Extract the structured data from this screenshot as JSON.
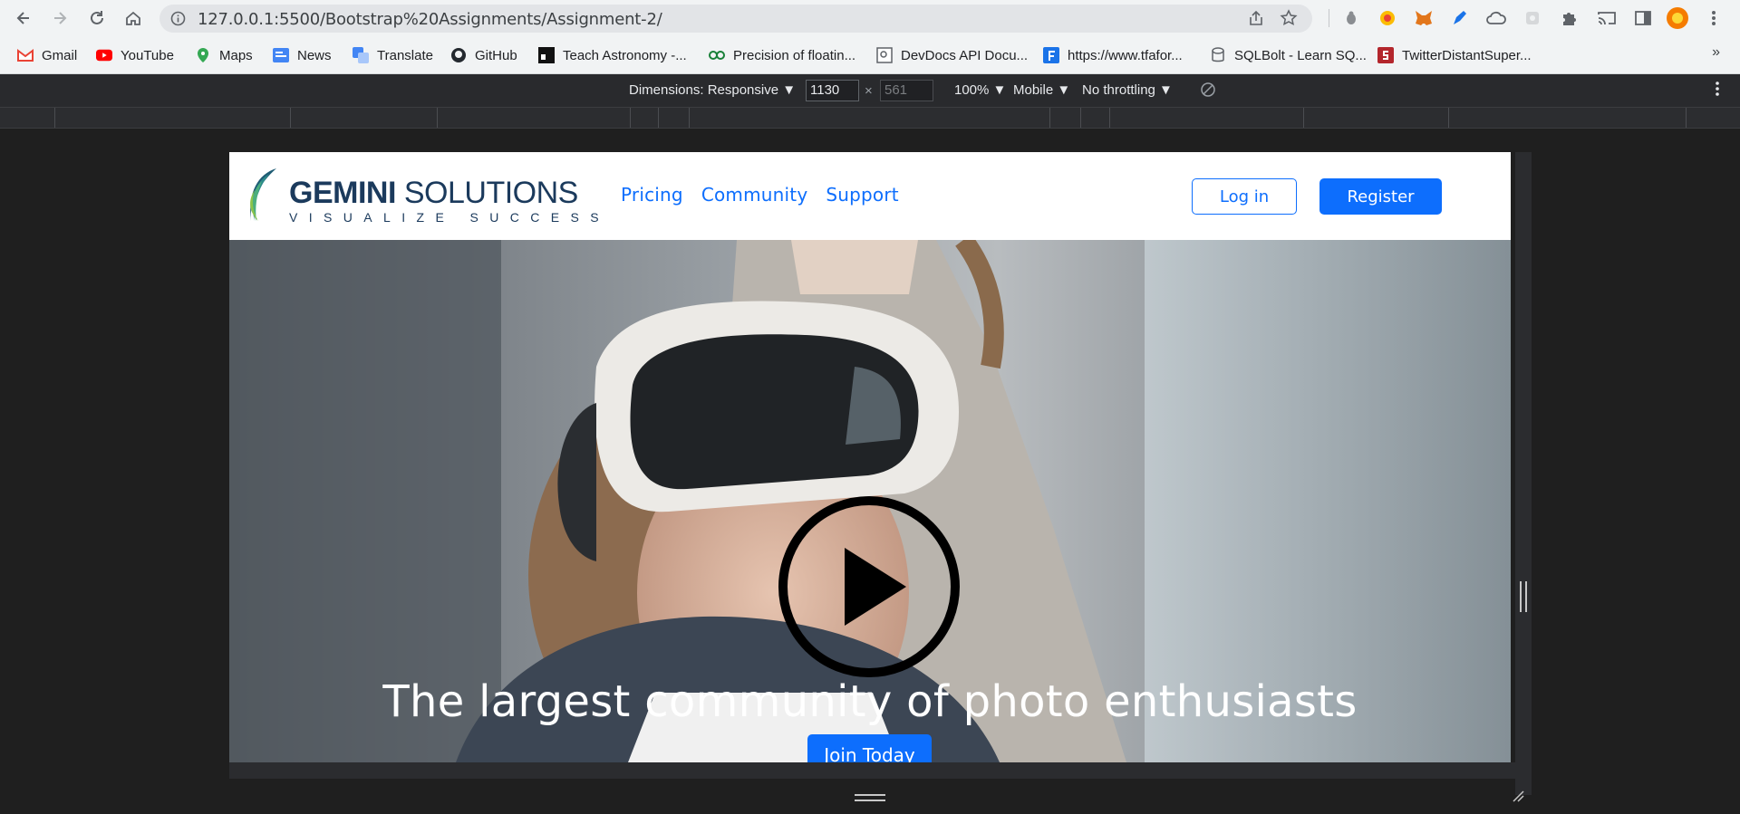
{
  "browser": {
    "url": "127.0.0.1:5500/Bootstrap%20Assignments/Assignment-2/",
    "bookmarks": [
      {
        "label": "Gmail",
        "icon": "gmail-icon"
      },
      {
        "label": "YouTube",
        "icon": "youtube-icon"
      },
      {
        "label": "Maps",
        "icon": "maps-icon"
      },
      {
        "label": "News",
        "icon": "news-icon"
      },
      {
        "label": "Translate",
        "icon": "translate-icon"
      },
      {
        "label": "GitHub",
        "icon": "github-icon"
      },
      {
        "label": "Teach Astronomy -...",
        "icon": "teach-astronomy-icon"
      },
      {
        "label": "Precision of floatin...",
        "icon": "precision-icon"
      },
      {
        "label": "DevDocs API Docu...",
        "icon": "devdocs-icon"
      },
      {
        "label": "https://www.tfafor...",
        "icon": "tfa-icon"
      },
      {
        "label": "SQLBolt - Learn SQ...",
        "icon": "sqlbolt-icon"
      },
      {
        "label": "TwitterDistantSuper...",
        "icon": "twitter-distant-icon"
      }
    ]
  },
  "devtools": {
    "dimensions_label": "Dimensions: Responsive",
    "width": "1130",
    "height": "561",
    "zoom": "100%",
    "device_type": "Mobile",
    "throttling": "No throttling"
  },
  "site": {
    "logo": {
      "name_bold": "GEMINI",
      "name_rest": " SOLUTIONS",
      "tagline": "VISUALIZE SUCCESS"
    },
    "nav": [
      "Pricing",
      "Community",
      "Support"
    ],
    "login_label": "Log in",
    "register_label": "Register",
    "hero_headline": "The largest community of photo enthusiasts",
    "join_label": "Join Today"
  },
  "colors": {
    "primary": "#0d6efd",
    "logo_text": "#1b3a5c",
    "browser_bar": "#f1f3f4",
    "devtools_bg": "#292a2d"
  }
}
